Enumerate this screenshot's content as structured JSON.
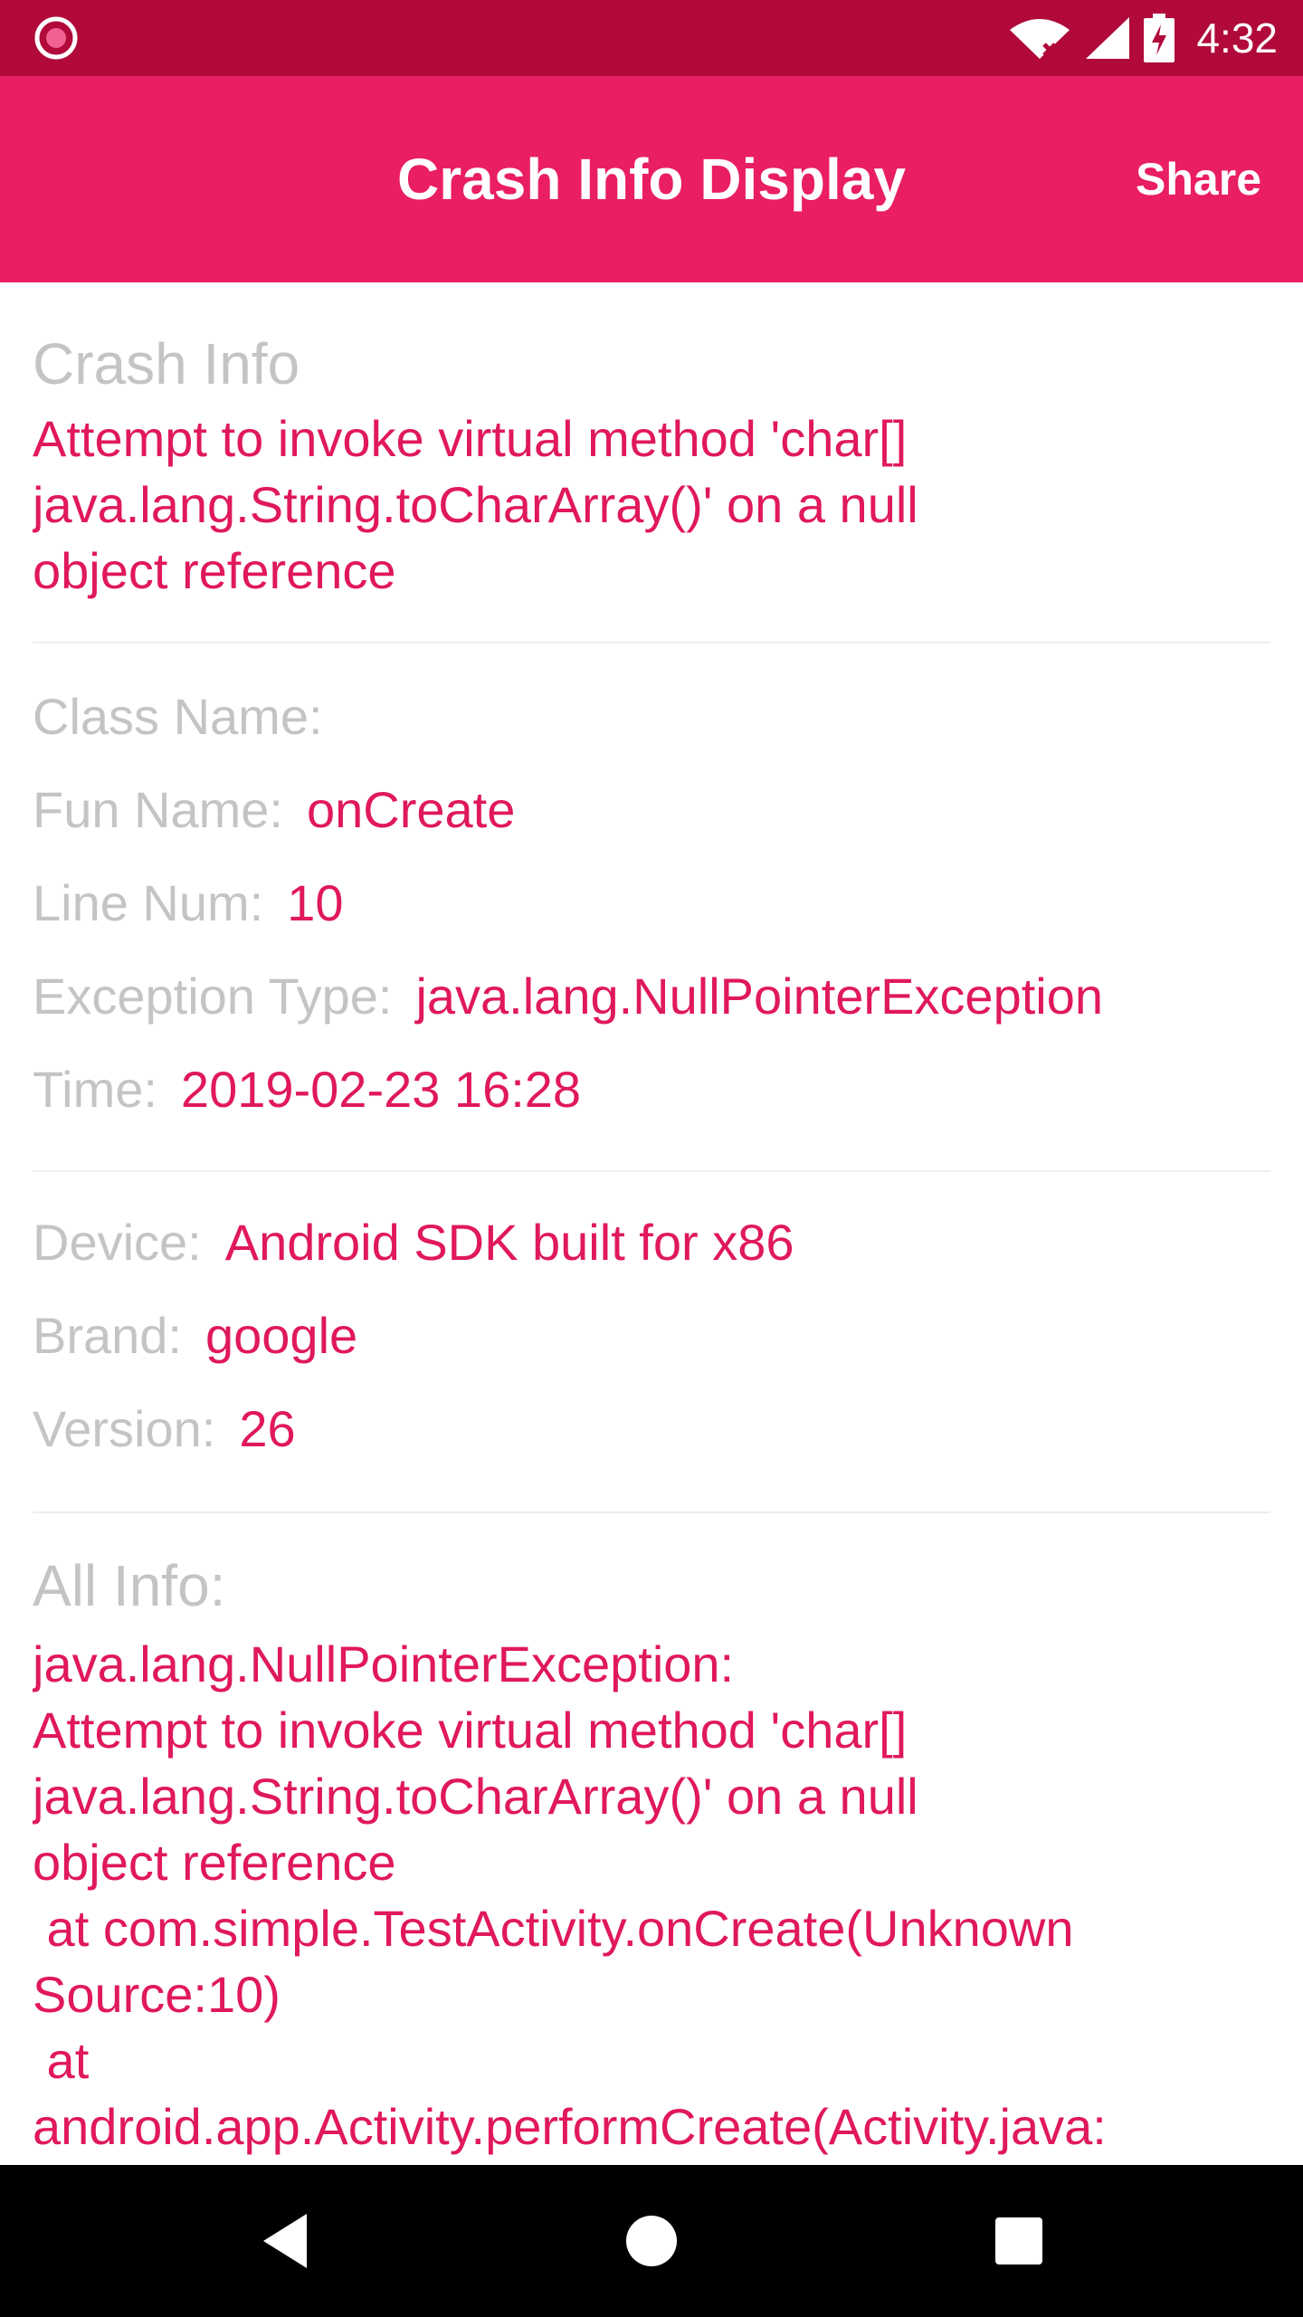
{
  "status_bar": {
    "time": "4:32",
    "icons": [
      "record-icon",
      "wifi-icon",
      "cellular-signal-icon",
      "battery-charging-icon"
    ]
  },
  "app_bar": {
    "title": "Crash Info Display",
    "share_label": "Share"
  },
  "crash_info": {
    "title": "Crash Info",
    "message_lines": [
      "Attempt to invoke virtual method 'char[]",
      "java.lang.String.toCharArray()' on a null",
      "object reference"
    ]
  },
  "details": {
    "class_name_label": "Class Name:",
    "class_name_value": "",
    "fun_name_label": "Fun Name:",
    "fun_name_value": "onCreate",
    "line_num_label": "Line Num:",
    "line_num_value": "10",
    "exception_type_label": "Exception Type:",
    "exception_type_value": "java.lang.NullPointerException",
    "time_label": "Time:",
    "time_value": "2019-02-23 16:28"
  },
  "device": {
    "device_label": "Device:",
    "device_value": "Android SDK built for x86",
    "brand_label": "Brand:",
    "brand_value": "google",
    "version_label": "Version:",
    "version_value": "26"
  },
  "all_info": {
    "title": "All Info:",
    "lines": [
      "java.lang.NullPointerException:",
      "Attempt to invoke virtual method 'char[]",
      "java.lang.String.toCharArray()' on a null",
      "object reference",
      " at com.simple.TestActivity.onCreate(Unknown",
      "Source:10)",
      " at",
      "android.app.Activity.performCreate(Activity.java:"
    ]
  },
  "nav_bar": {
    "icons": [
      "back-icon",
      "home-icon",
      "recents-icon"
    ]
  },
  "colors": {
    "status_bar": "#b0093a",
    "app_bar": "#e91e63",
    "accent_text": "#e0185c",
    "label_text": "#c4c4c4"
  }
}
